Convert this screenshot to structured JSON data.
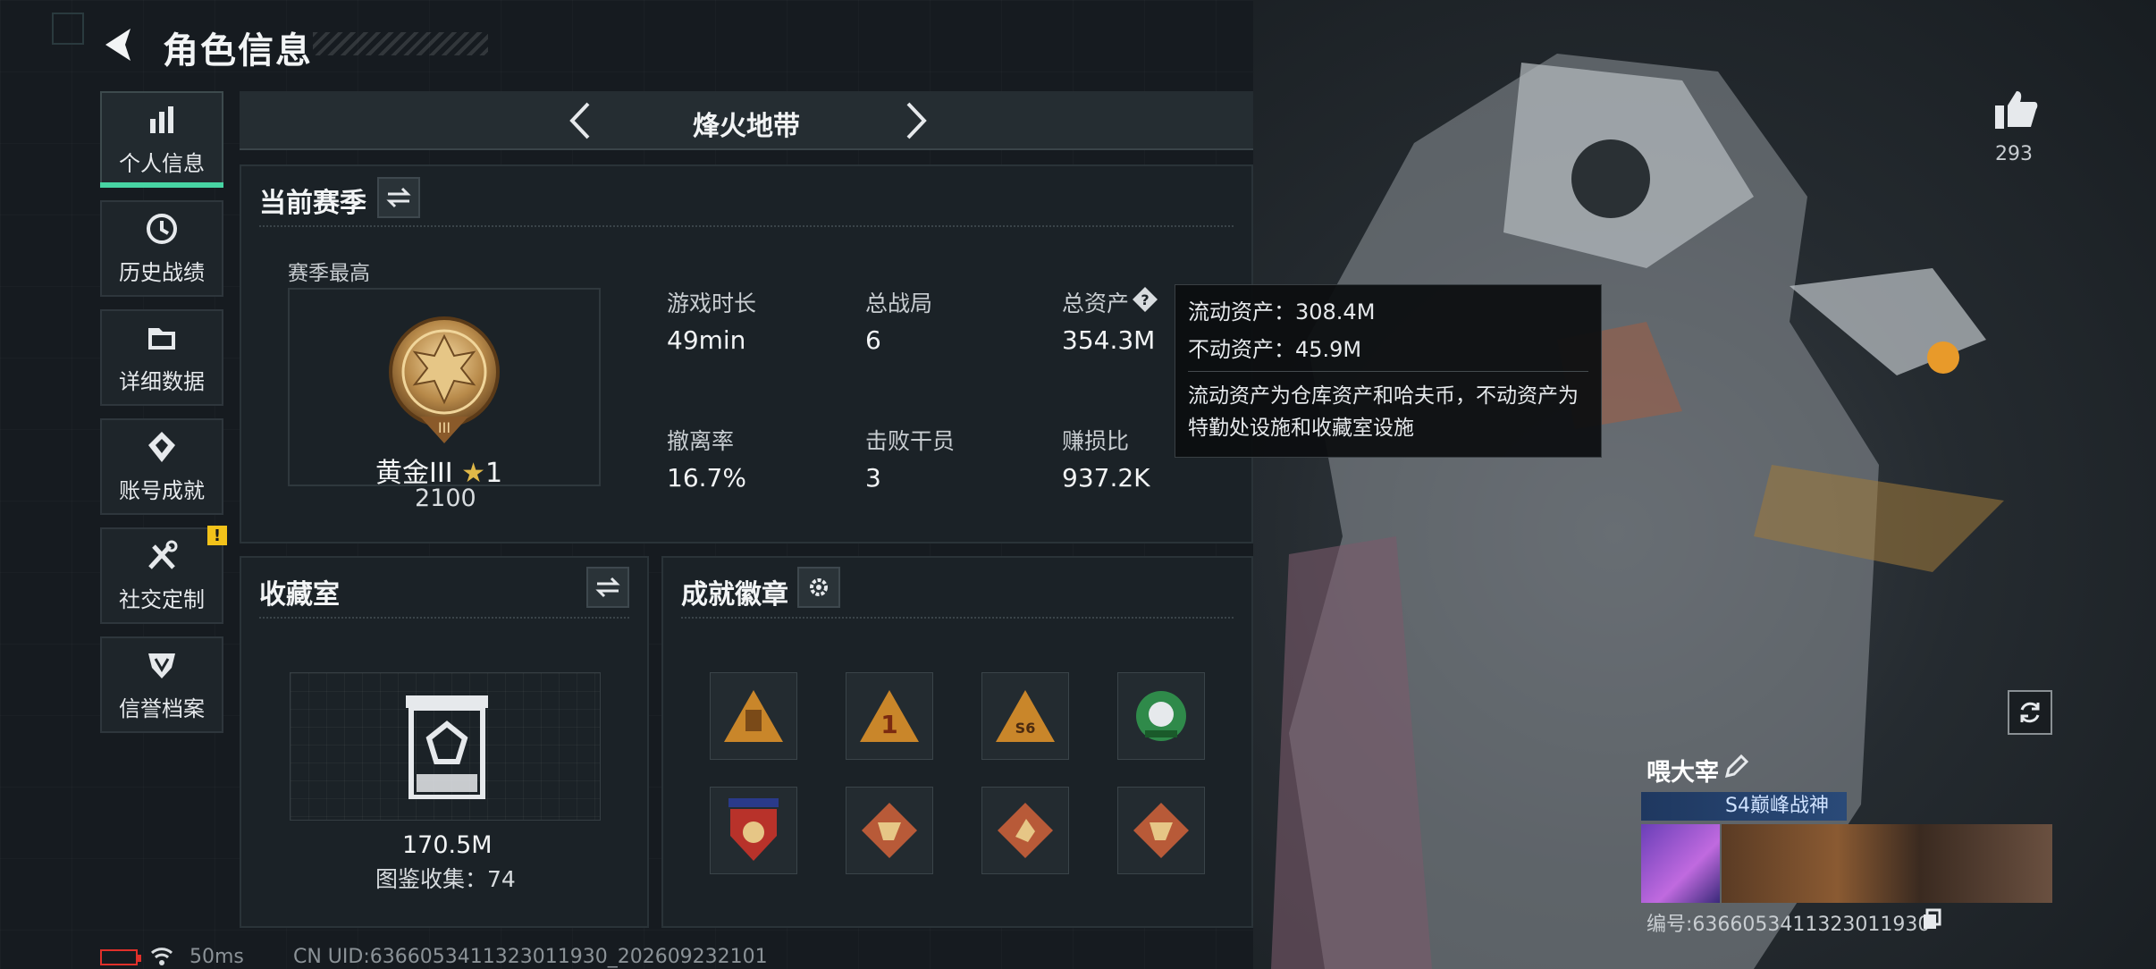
{
  "header": {
    "title": "角色信息"
  },
  "nav": {
    "items": [
      {
        "label": "个人信息",
        "icon": "bar-chart-icon",
        "active": true
      },
      {
        "label": "历史战绩",
        "icon": "clock-icon"
      },
      {
        "label": "详细数据",
        "icon": "folder-icon"
      },
      {
        "label": "账号成就",
        "icon": "achievement-icon"
      },
      {
        "label": "社交定制",
        "icon": "tools-icon",
        "badge": "!"
      },
      {
        "label": "信誉档案",
        "icon": "shield-icon"
      }
    ]
  },
  "mode": {
    "label": "烽火地带"
  },
  "season": {
    "title": "当前赛季",
    "highest_label": "赛季最高",
    "rank_name": "黄金III",
    "rank_stars": "1",
    "rank_score": "2100",
    "stats": [
      {
        "label": "游戏时长",
        "value": "49min"
      },
      {
        "label": "总战局",
        "value": "6"
      },
      {
        "label": "总资产",
        "value": "354.3M"
      },
      {
        "label": "撤离率",
        "value": "16.7%"
      },
      {
        "label": "击败干员",
        "value": "3"
      },
      {
        "label": "赚损比",
        "value": "937.2K"
      }
    ]
  },
  "tooltip": {
    "liquid": "流动资产：308.4M",
    "fixed": "不动资产：45.9M",
    "desc": "流动资产为仓库资产和哈夫币，不动资产为特勤处设施和收藏室设施"
  },
  "collection": {
    "title": "收藏室",
    "value": "170.5M",
    "catalog": "图鉴收集：74"
  },
  "badges": {
    "title": "成就徽章",
    "count": 8,
    "colors": [
      "#c9862a",
      "#c9862a",
      "#c9862a",
      "#2f8a4a",
      "#b8322a",
      "#b85a38",
      "#b85a38",
      "#b85a38"
    ]
  },
  "profile": {
    "likes": "293",
    "name": "喂大宰",
    "title_badge": "S4巅峰战神",
    "id": "编号:6366053411323011930"
  },
  "status": {
    "ping": "50ms",
    "uid": "CN UID:6366053411323011930_202609232101"
  },
  "colors": {
    "accent": "#47d4a3",
    "warning": "#f2c21a",
    "battery": "#e0302a"
  }
}
